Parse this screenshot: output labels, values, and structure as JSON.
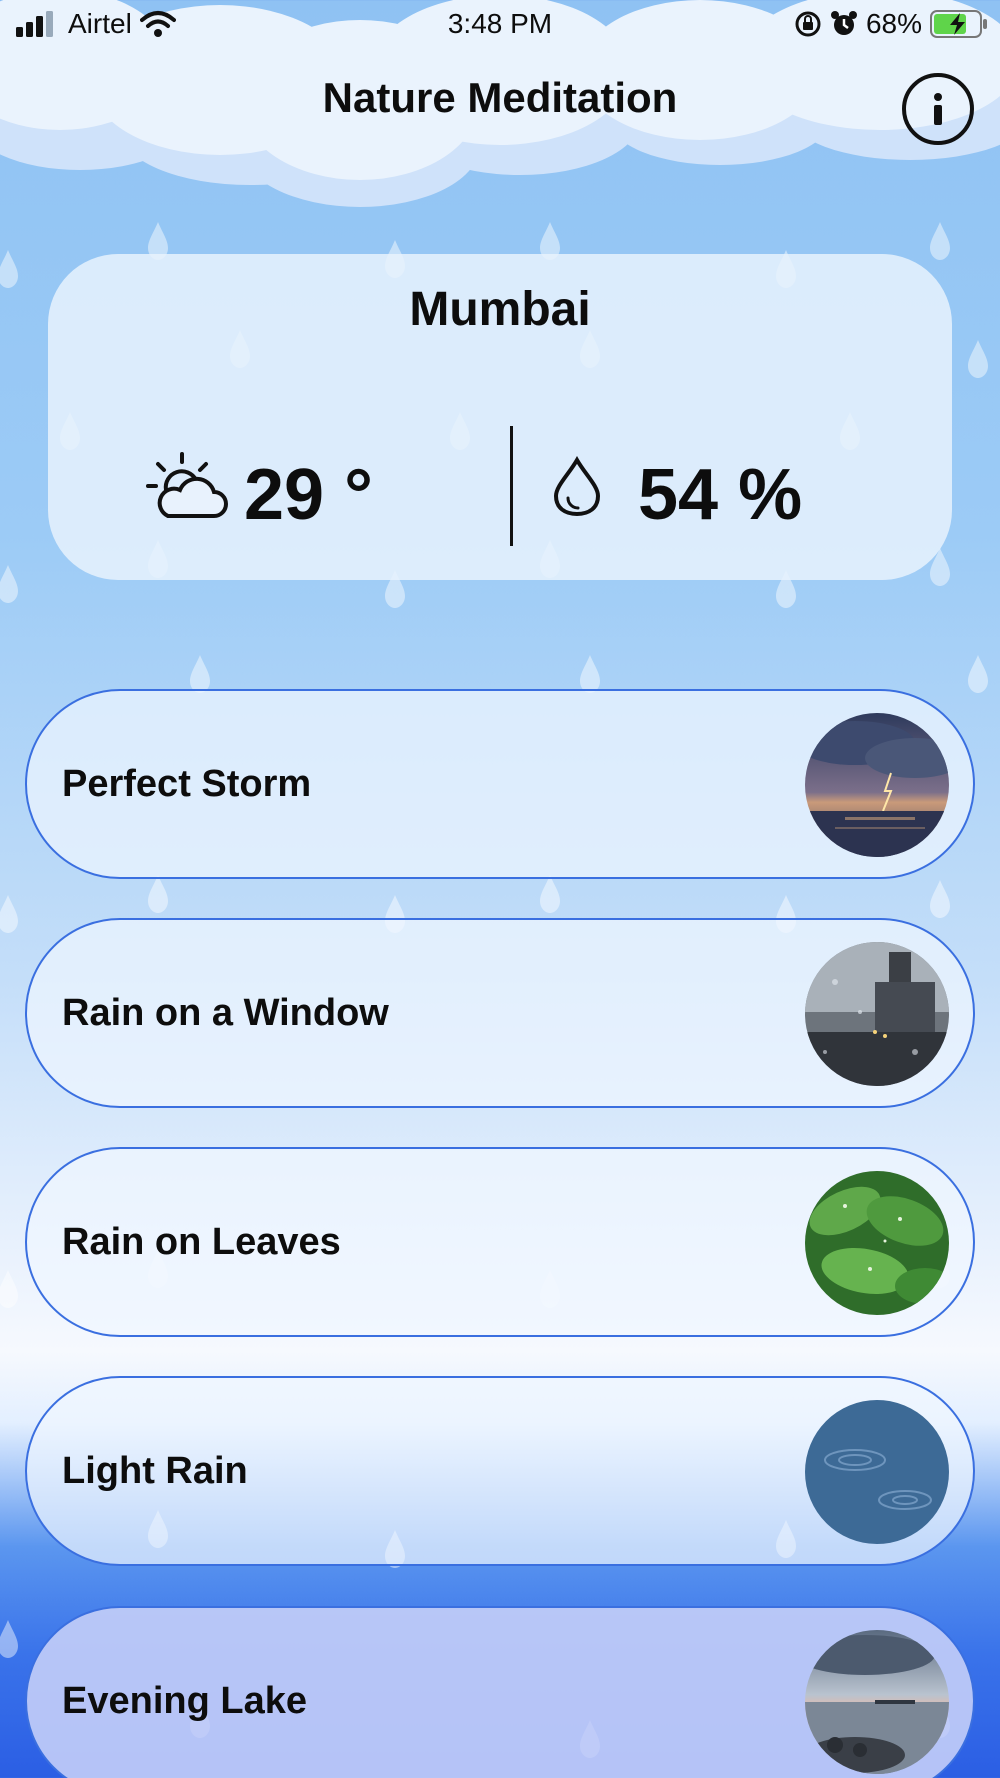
{
  "status_bar": {
    "carrier": "Airtel",
    "time": "3:48 PM",
    "battery": "68%"
  },
  "header": {
    "title": "Nature Meditation",
    "info_icon": "info-icon"
  },
  "weather": {
    "city": "Mumbai",
    "temperature": "29 °",
    "humidity": "54 %",
    "temp_icon": "sun-cloud-icon",
    "humidity_icon": "water-drop-icon"
  },
  "sounds": [
    {
      "label": "Perfect Storm",
      "thumbnail": "storm-lightning-image"
    },
    {
      "label": "Rain on a Window",
      "thumbnail": "rain-window-image"
    },
    {
      "label": "Rain on Leaves",
      "thumbnail": "rain-leaves-image"
    },
    {
      "label": "Light Rain",
      "thumbnail": "light-rain-water-image"
    },
    {
      "label": "Evening Lake",
      "thumbnail": "evening-lake-image"
    }
  ],
  "colors": {
    "accent_border": "#3a6fe0",
    "sky_top": "#8fc2f3",
    "water_bottom": "#2b5ee4",
    "battery_green": "#5fd44a"
  }
}
